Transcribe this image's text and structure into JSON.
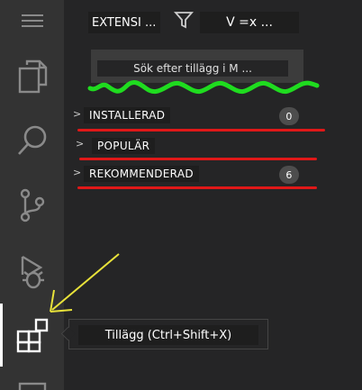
{
  "activity_bar": {
    "items": [
      {
        "name": "menu-icon"
      },
      {
        "name": "explorer-icon"
      },
      {
        "name": "search-icon"
      },
      {
        "name": "source-control-icon"
      },
      {
        "name": "run-debug-icon"
      },
      {
        "name": "extensions-icon"
      },
      {
        "name": "remote-icon"
      }
    ]
  },
  "sidebar": {
    "title": "EXTENSI ...",
    "filter_icon": "filter-icon",
    "view_options": "V =x ...",
    "search_placeholder": "Sök efter tillägg i M ...",
    "sections": [
      {
        "label": "INSTALLERAD",
        "count": "0"
      },
      {
        "label": "POPULÄR",
        "count": ""
      },
      {
        "label": "REKOMMENDERAD",
        "count": "6"
      }
    ]
  },
  "tooltip": {
    "text": "Tillägg (Ctrl+Shift+X)"
  },
  "colors": {
    "activity_bar": "#333333",
    "sidebar": "#252526",
    "annotation_red": "#e01818",
    "annotation_green": "#1fdc1f",
    "annotation_yellow": "#e8e23a"
  }
}
